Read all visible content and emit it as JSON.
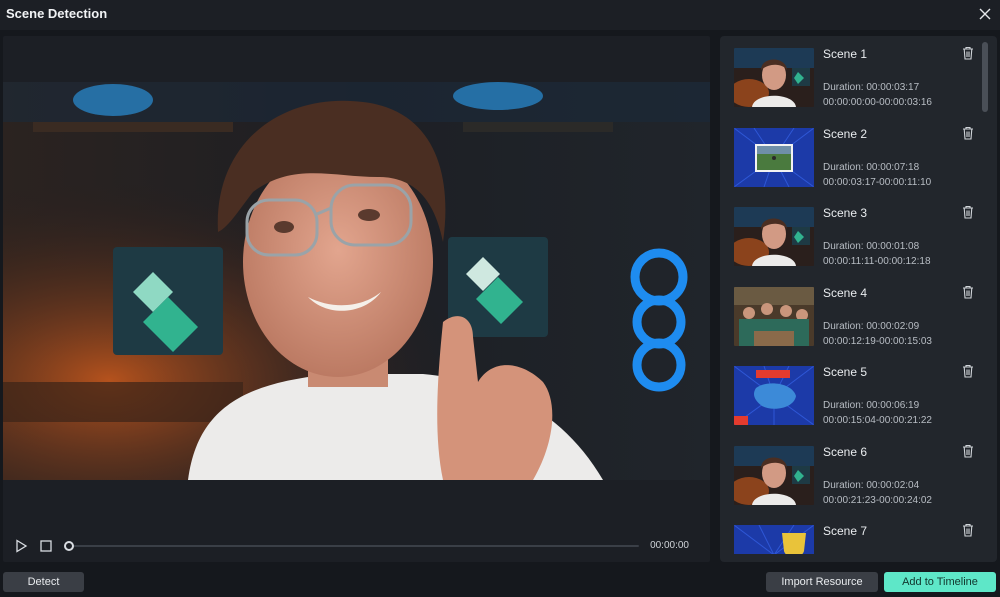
{
  "window": {
    "title": "Scene Detection"
  },
  "player": {
    "time": "00:00:00",
    "progress": 0
  },
  "scenes": [
    {
      "name": "Scene 1",
      "duration": "Duration: 00:00:03:17",
      "range": "00:00:00:00-00:00:03:16",
      "thumb": "person"
    },
    {
      "name": "Scene 2",
      "duration": "Duration: 00:00:07:18",
      "range": "00:00:03:17-00:00:11:10",
      "thumb": "blue-field"
    },
    {
      "name": "Scene 3",
      "duration": "Duration: 00:00:01:08",
      "range": "00:00:11:11-00:00:12:18",
      "thumb": "person"
    },
    {
      "name": "Scene 4",
      "duration": "Duration: 00:00:02:09",
      "range": "00:00:12:19-00:00:15:03",
      "thumb": "group"
    },
    {
      "name": "Scene 5",
      "duration": "Duration: 00:00:06:19",
      "range": "00:00:15:04-00:00:21:22",
      "thumb": "blue-map"
    },
    {
      "name": "Scene 6",
      "duration": "Duration: 00:00:02:04",
      "range": "00:00:21:23-00:00:24:02",
      "thumb": "person"
    },
    {
      "name": "Scene 7",
      "duration": "",
      "range": "",
      "thumb": "trophy"
    }
  ],
  "buttons": {
    "detect": "Detect",
    "import": "Import Resource",
    "add": "Add to Timeline"
  },
  "colors": {
    "accent": "#5ee7c8",
    "panel": "#22262c",
    "background": "#15181d"
  }
}
